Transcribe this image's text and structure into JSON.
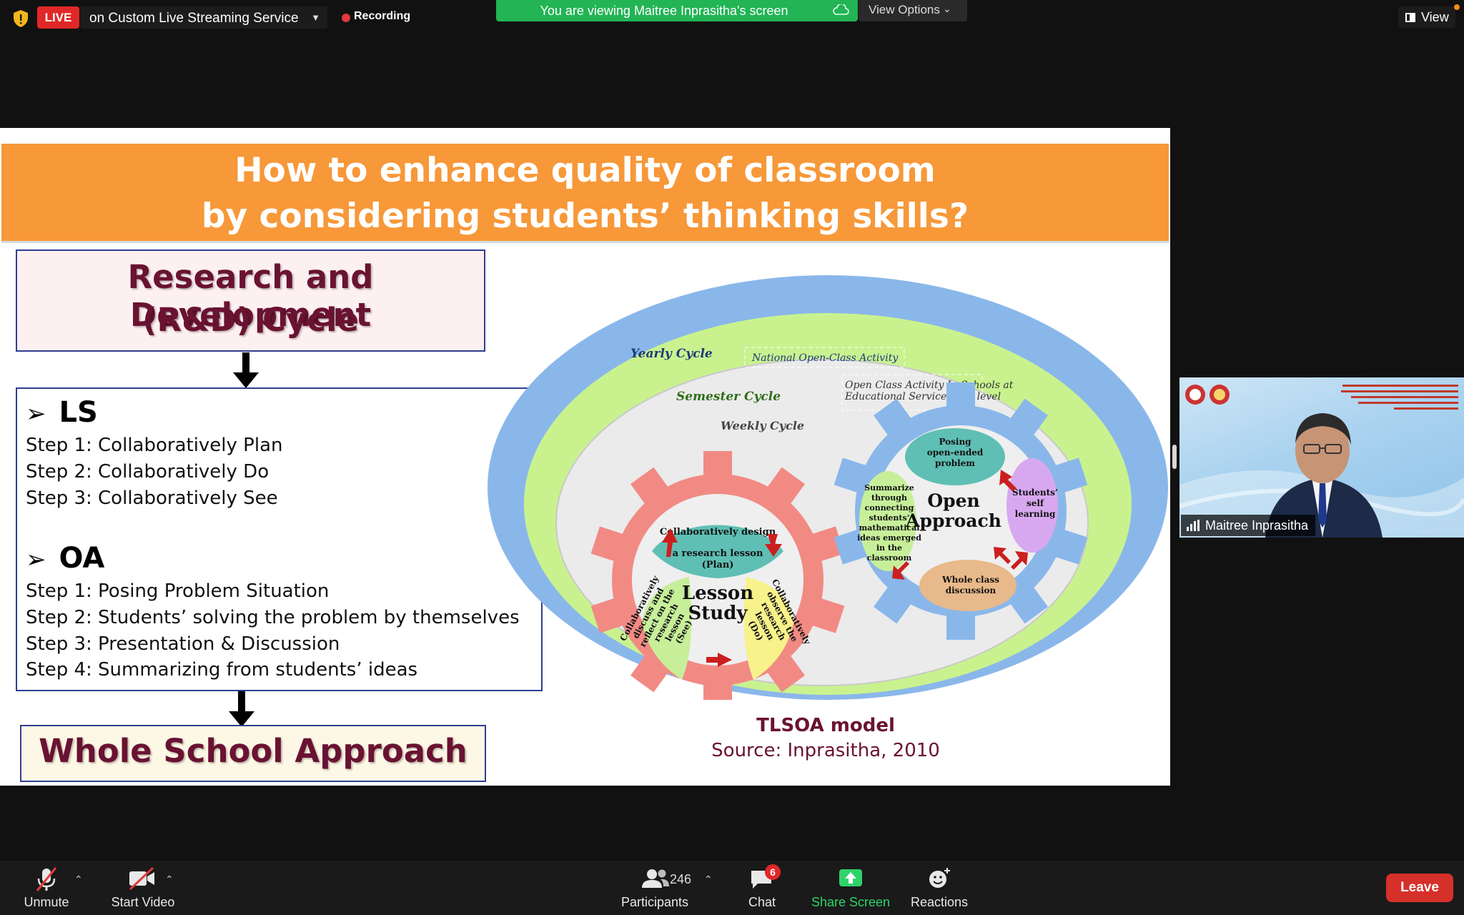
{
  "top_bar": {
    "live_badge": "LIVE",
    "stream_label": "on Custom Live Streaming Service",
    "recording_label": "Recording",
    "viewing_banner": "You are viewing Maitree Inprasitha's screen",
    "view_options_label": "View Options",
    "view_label": "View"
  },
  "slide": {
    "title_line1": "How to enhance quality of classroom",
    "title_line2": "by considering students’ thinking skills?",
    "rd_line1": "Research and Development",
    "rd_line2": "(R&D) Cycle",
    "ls_heading": "LS",
    "ls_steps": [
      "Step 1: Collaboratively Plan",
      "Step 2: Collaboratively Do",
      "Step 3: Collaboratively See"
    ],
    "oa_heading": "OA",
    "oa_steps": [
      "Step 1: Posing Problem Situation",
      "Step 2: Students’ solving the problem by themselves",
      "Step 3: Presentation & Discussion",
      "Step 4: Summarizing from students’ ideas"
    ],
    "whole_school": "Whole School Approach",
    "diagram": {
      "yearly_cycle": "Yearly Cycle",
      "national_activity": "National Open-Class Activity",
      "semester_cycle": "Semester Cycle",
      "open_class_line1": "Open Class Activity In Schools  at",
      "open_class_line2": "Educational Service Area level",
      "weekly_cycle": "Weekly Cycle",
      "lesson_study_1": "Lesson",
      "lesson_study_2": "Study",
      "plan_1": "Collaboratively design",
      "plan_2": "a research lesson",
      "plan_3": "(Plan)",
      "do_1": "Collaboratively",
      "do_2": "observe the",
      "do_3": "research",
      "do_4": "lesson",
      "do_5": "(Do)",
      "see_1": "Collaboratively",
      "see_2": "discuss and",
      "see_3": "reflect on the",
      "see_4": "research",
      "see_5": "lesson",
      "see_6": "(See)",
      "open_approach_1": "Open",
      "open_approach_2": "Approach",
      "posing_1": "Posing",
      "posing_2": "open-ended",
      "posing_3": "problem",
      "self_1": "Students’",
      "self_2": "self",
      "self_3": "learning",
      "whole_1": "Whole class",
      "whole_2": "discussion",
      "summ_1": "Summarize",
      "summ_2": "through",
      "summ_3": "connecting",
      "summ_4": "students’",
      "summ_5": "mathematical",
      "summ_6": "ideas emerged",
      "summ_7": "in the",
      "summ_8": "classroom"
    },
    "caption_title": "TLSOA model",
    "caption_source": "Source: Inprasitha, 2010"
  },
  "participant": {
    "name": "Maitree Inprasitha"
  },
  "toolbar": {
    "unmute": "Unmute",
    "start_video": "Start Video",
    "participants": "Participants",
    "participant_count": "246",
    "chat": "Chat",
    "chat_badge": "6",
    "share_screen": "Share Screen",
    "reactions": "Reactions",
    "leave": "Leave"
  },
  "colors": {
    "live_red": "#e02828",
    "banner_green": "#22b455",
    "title_orange": "#f79839",
    "maroon_text": "#6a1232",
    "leave_red": "#d6302a"
  }
}
